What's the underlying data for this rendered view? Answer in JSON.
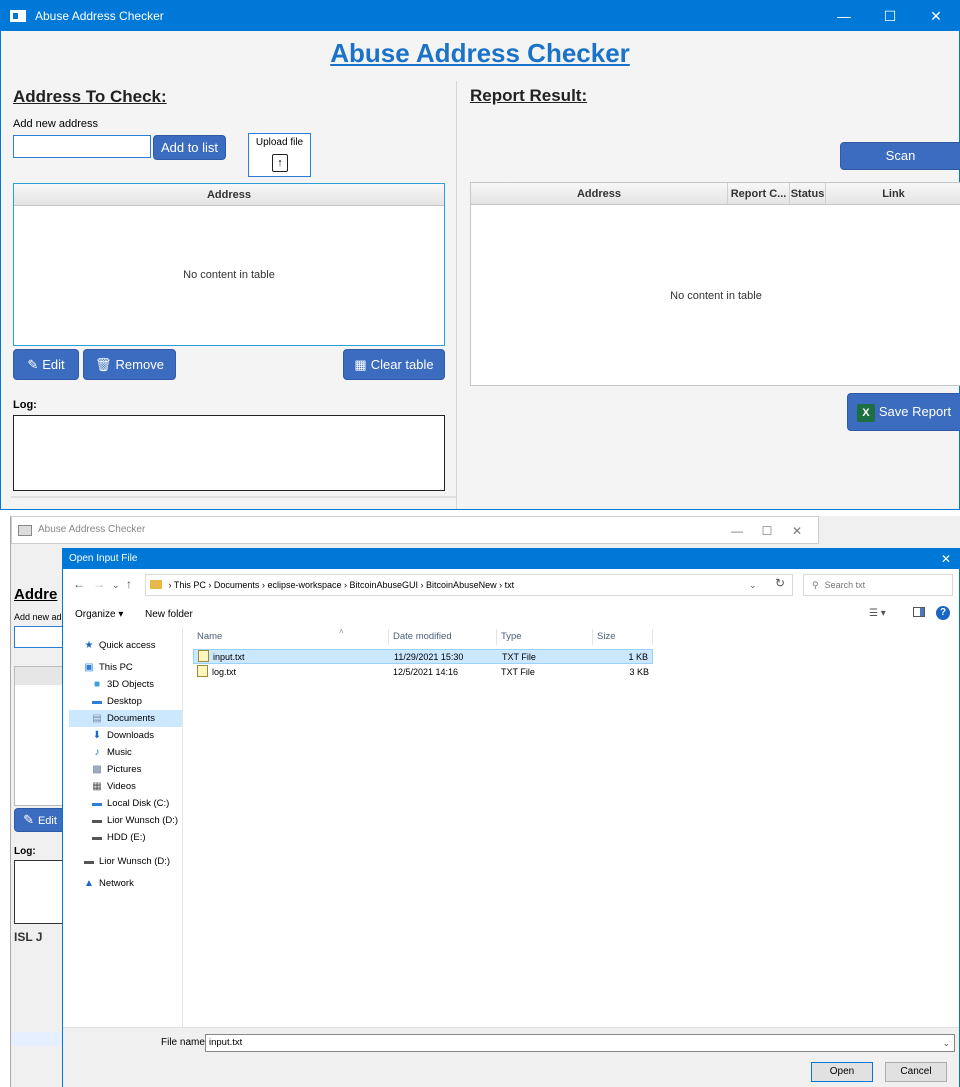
{
  "main_window": {
    "title": "Abuse Address Checker",
    "heading": "Abuse Address Checker",
    "left": {
      "section_title": "Address To Check:",
      "add_label": "Add new address",
      "input_value": "",
      "add_button": "Add to list",
      "upload_label": "Upload file",
      "table": {
        "columns": [
          "Address"
        ],
        "empty_text": "No content in table"
      },
      "edit_button": "Edit",
      "remove_button": "Remove",
      "clear_button": "Clear table",
      "log_label": "Log:"
    },
    "right": {
      "section_title": "Report Result:",
      "scan_button": "Scan",
      "table": {
        "columns": [
          "Address",
          "Report C...",
          "Status",
          "Link"
        ],
        "empty_text": "No content in table"
      },
      "save_button": "Save Report"
    }
  },
  "background_window": {
    "title": "Abuse Address Checker",
    "section_title": "Addre",
    "add_label": "Add new ad",
    "edit_button": "Edit",
    "log_label": "Log:",
    "stray_text": "ISL J"
  },
  "dialog": {
    "title": "Open Input File",
    "breadcrumb": [
      "This PC",
      "Documents",
      "eclipse-workspace",
      "BitcoinAbuseGUI",
      "BitcoinAbuseNew",
      "txt"
    ],
    "search_placeholder": "Search txt",
    "organize": "Organize ▾",
    "new_folder": "New folder",
    "nav": [
      {
        "label": "Quick access",
        "icon": "star-icon"
      },
      {
        "label": "This PC",
        "icon": "computer-icon"
      },
      {
        "label": "3D Objects",
        "icon": "cube-icon"
      },
      {
        "label": "Desktop",
        "icon": "desktop-icon"
      },
      {
        "label": "Documents",
        "icon": "document-icon"
      },
      {
        "label": "Downloads",
        "icon": "download-icon"
      },
      {
        "label": "Music",
        "icon": "music-icon"
      },
      {
        "label": "Pictures",
        "icon": "picture-icon"
      },
      {
        "label": "Videos",
        "icon": "video-icon"
      },
      {
        "label": "Local Disk (C:)",
        "icon": "disk-icon"
      },
      {
        "label": "Lior Wunsch (D:)",
        "icon": "drive-icon"
      },
      {
        "label": "HDD (E:)",
        "icon": "drive-icon"
      },
      {
        "label": "Lior Wunsch (D:)",
        "icon": "drive-icon"
      },
      {
        "label": "Network",
        "icon": "network-icon"
      }
    ],
    "columns": [
      "Name",
      "Date modified",
      "Type",
      "Size"
    ],
    "files": [
      {
        "name": "input.txt",
        "date": "11/29/2021 15:30",
        "type": "TXT File",
        "size": "1 KB"
      },
      {
        "name": "log.txt",
        "date": "12/5/2021 14:16",
        "type": "TXT File",
        "size": "3 KB"
      }
    ],
    "file_name_label": "File name:",
    "file_name_value": "input.txt",
    "open_button": "Open",
    "cancel_button": "Cancel"
  },
  "colors": {
    "titlebar": "#0078d7",
    "heading": "#1a73c8",
    "button": "#3c6cbf",
    "selection": "#cce8ff"
  }
}
